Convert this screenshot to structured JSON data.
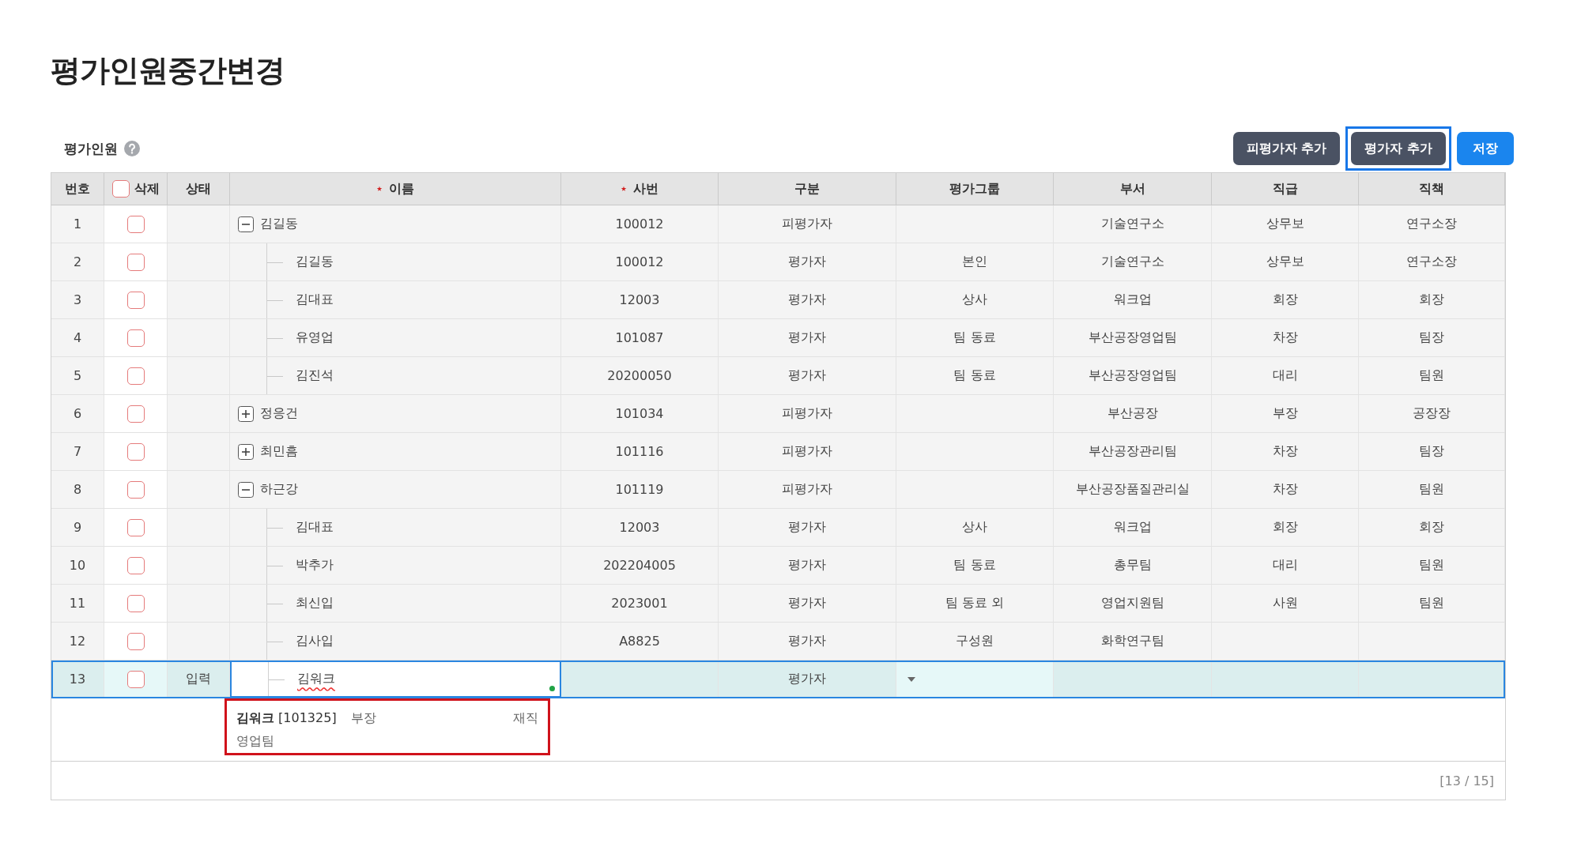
{
  "page_title": "평가인원중간변경",
  "section": {
    "label": "평가인원"
  },
  "buttons": [
    {
      "label": "피평가자 추가",
      "kind": "dark",
      "focused": false
    },
    {
      "label": "평가자 추가",
      "kind": "dark",
      "focused": true
    },
    {
      "label": "저장",
      "kind": "primary",
      "focused": false
    }
  ],
  "table": {
    "columns": [
      {
        "kind": "text",
        "label": "번호",
        "required": false
      },
      {
        "kind": "checkbox",
        "label": "삭제",
        "required": false,
        "checked": false
      },
      {
        "kind": "text",
        "label": "상태",
        "required": false
      },
      {
        "kind": "text",
        "label": "이름",
        "required": true
      },
      {
        "kind": "text",
        "label": "사번",
        "required": true
      },
      {
        "kind": "text",
        "label": "구분",
        "required": false
      },
      {
        "kind": "text",
        "label": "평가그룹",
        "required": false
      },
      {
        "kind": "text",
        "label": "부서",
        "required": false
      },
      {
        "kind": "text",
        "label": "직급",
        "required": false
      },
      {
        "kind": "text",
        "label": "직책",
        "required": false
      }
    ],
    "rows": [
      {
        "no": "1",
        "checked": false,
        "selected": false,
        "editing": false,
        "expanded": true,
        "name": "김길동",
        "emp_no": "100012",
        "type": "피평가자",
        "dept": "기술연구소",
        "grade": "상무보",
        "duty": "연구소장",
        "children": [
          {
            "no": "2",
            "checked": false,
            "selected": false,
            "editing": false,
            "name": "김길동",
            "emp_no": "100012",
            "type": "평가자",
            "group": "본인",
            "dept": "기술연구소",
            "grade": "상무보",
            "duty": "연구소장"
          },
          {
            "no": "3",
            "checked": false,
            "selected": false,
            "editing": false,
            "name": "김대표",
            "emp_no": "12003",
            "type": "평가자",
            "group": "상사",
            "dept": "워크업",
            "grade": "회장",
            "duty": "회장"
          },
          {
            "no": "4",
            "checked": false,
            "selected": false,
            "editing": false,
            "name": "유영업",
            "emp_no": "101087",
            "type": "평가자",
            "group": "팀 동료",
            "dept": "부산공장영업팀",
            "grade": "차장",
            "duty": "팀장"
          },
          {
            "no": "5",
            "checked": false,
            "selected": false,
            "editing": false,
            "name": "김진석",
            "emp_no": "20200050",
            "type": "평가자",
            "group": "팀 동료",
            "dept": "부산공장영업팀",
            "grade": "대리",
            "duty": "팀원"
          }
        ]
      },
      {
        "no": "6",
        "checked": false,
        "selected": false,
        "editing": false,
        "expanded": false,
        "name": "정응건",
        "emp_no": "101034",
        "type": "피평가자",
        "dept": "부산공장",
        "grade": "부장",
        "duty": "공장장"
      },
      {
        "no": "7",
        "checked": false,
        "selected": false,
        "editing": false,
        "expanded": false,
        "name": "최민흠",
        "emp_no": "101116",
        "type": "피평가자",
        "dept": "부산공장관리팀",
        "grade": "차장",
        "duty": "팀장"
      },
      {
        "no": "8",
        "checked": false,
        "selected": false,
        "editing": false,
        "expanded": true,
        "name": "하근강",
        "emp_no": "101119",
        "type": "피평가자",
        "dept": "부산공장품질관리실",
        "grade": "차장",
        "duty": "팀원",
        "children": [
          {
            "no": "9",
            "checked": false,
            "selected": false,
            "editing": false,
            "name": "김대표",
            "emp_no": "12003",
            "type": "평가자",
            "group": "상사",
            "dept": "워크업",
            "grade": "회장",
            "duty": "회장"
          },
          {
            "no": "10",
            "checked": false,
            "selected": false,
            "editing": false,
            "name": "박추가",
            "emp_no": "202204005",
            "type": "평가자",
            "group": "팀 동료",
            "dept": "총무팀",
            "grade": "대리",
            "duty": "팀원"
          },
          {
            "no": "11",
            "checked": false,
            "selected": false,
            "editing": false,
            "name": "최신입",
            "emp_no": "2023001",
            "type": "평가자",
            "group": "팀 동료 외",
            "dept": "영업지원팀",
            "grade": "사원",
            "duty": "팀원"
          },
          {
            "no": "12",
            "checked": false,
            "selected": false,
            "editing": false,
            "name": "김사입",
            "emp_no": "A8825",
            "type": "평가자",
            "group": "구성원",
            "dept": "화학연구팀"
          },
          {
            "no": "13",
            "checked": false,
            "selected": true,
            "editing": true,
            "status": "입력",
            "name": "김워크",
            "type": "평가자"
          }
        ]
      }
    ]
  },
  "suggestion": {
    "title": "**김워크** [101325]",
    "rank": "부장",
    "state": "재직",
    "dept": "영업팀"
  },
  "footer": {
    "count": "[13 / 15]"
  }
}
